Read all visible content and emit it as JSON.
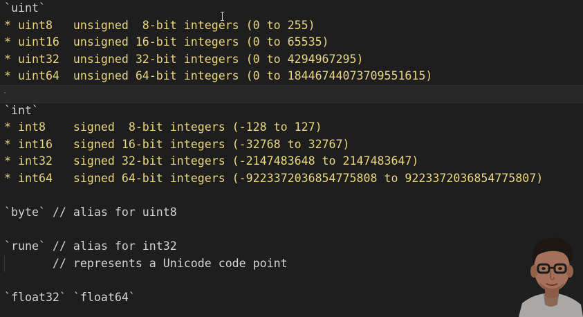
{
  "code_lines": [
    {
      "id": "uint-heading",
      "parts": [
        "`uint`"
      ],
      "colors": [
        "w"
      ]
    },
    {
      "id": "uint8",
      "parts": [
        "* uint8   unsigned  8-bit integers (0 to 255)"
      ],
      "colors": [
        "y"
      ]
    },
    {
      "id": "uint16",
      "parts": [
        "* uint16  unsigned 16-bit integers (0 to 65535)"
      ],
      "colors": [
        "y"
      ]
    },
    {
      "id": "uint32",
      "parts": [
        "* uint32  unsigned 32-bit integers (0 to 4294967295)"
      ],
      "colors": [
        "y"
      ]
    },
    {
      "id": "uint64",
      "parts": [
        "* uint64  unsigned 64-bit integers (0 to 18446744073709551615)"
      ],
      "colors": [
        "y"
      ]
    },
    {
      "id": "int-heading",
      "parts": [
        "`int`"
      ],
      "colors": [
        "w"
      ]
    },
    {
      "id": "int8",
      "parts": [
        "* int8    signed  8-bit integers (-128 to 127)"
      ],
      "colors": [
        "y"
      ]
    },
    {
      "id": "int16",
      "parts": [
        "* int16   signed 16-bit integers (-32768 to 32767)"
      ],
      "colors": [
        "y"
      ]
    },
    {
      "id": "int32",
      "parts": [
        "* int32   signed 32-bit integers (-2147483648 to 2147483647)"
      ],
      "colors": [
        "y"
      ]
    },
    {
      "id": "int64",
      "parts": [
        "* int64   signed 64-bit integers (-9223372036854775808 to 9223372036854775807)"
      ],
      "colors": [
        "y"
      ]
    },
    {
      "id": "byte-line",
      "parts": [
        "`byte` // alias for uint8"
      ],
      "colors": [
        "w"
      ]
    },
    {
      "id": "rune-line",
      "parts": [
        "`rune` // alias for int32"
      ],
      "colors": [
        "w"
      ]
    },
    {
      "id": "rune-comment",
      "parts": [
        "       // represents a Unicode code point"
      ],
      "colors": [
        "w"
      ]
    },
    {
      "id": "float-line",
      "parts": [
        "`float32` `float64`"
      ],
      "colors": [
        "w"
      ]
    }
  ],
  "colors": {
    "background": "#1e1e1e",
    "text": "#d4d4d4",
    "list_item": "#e9d77e",
    "current_line": "#282828"
  },
  "webcam": {
    "icon": "presenter-webcam"
  }
}
